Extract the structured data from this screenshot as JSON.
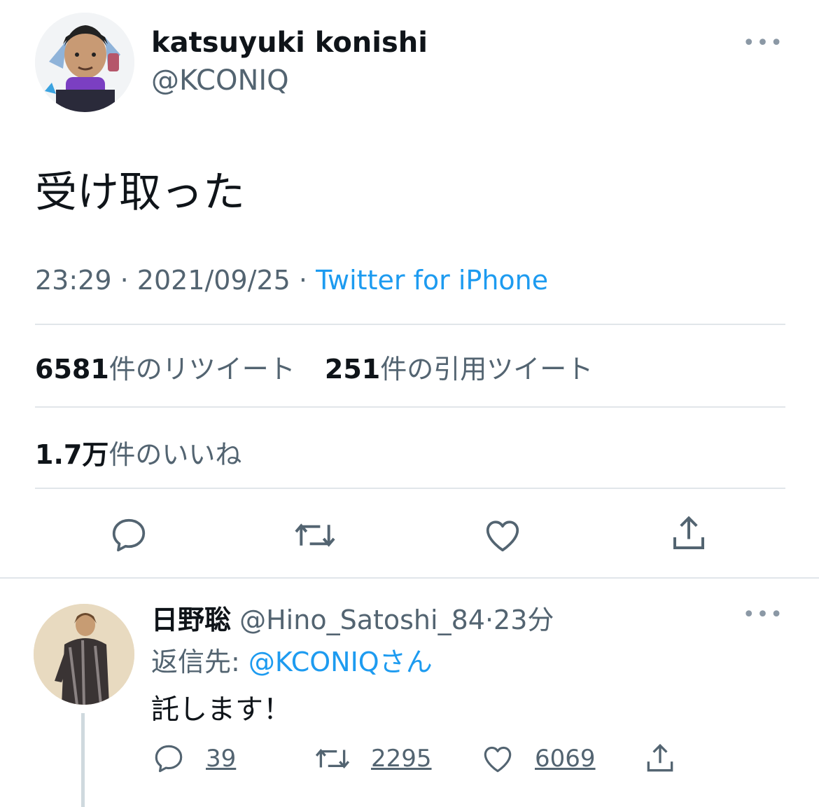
{
  "tweet": {
    "author": {
      "display_name": "katsuyuki konishi",
      "handle": "@KCONIQ"
    },
    "text": "受け取った",
    "time": "23:29",
    "date": "2021/09/25",
    "separator": "·",
    "source": "Twitter for iPhone",
    "stats": {
      "retweets_count": "6581",
      "retweets_label": "件のリツイート",
      "quotes_count": "251",
      "quotes_label": "件の引用ツイート",
      "likes_count": "1.7万",
      "likes_label": "件のいいね"
    },
    "more": "•••"
  },
  "reply": {
    "display_name": "日野聡",
    "handle": "@Hino_Satoshi_84",
    "separator": "·",
    "time_ago": "23分",
    "reply_to_prefix": "返信先: ",
    "reply_to_mention": "@KCONIQ",
    "reply_to_suffix": "さん",
    "text": "託します！",
    "reply_count": "39",
    "retweet_count": "2295",
    "like_count": "6069",
    "more": "•••"
  },
  "colors": {
    "accent": "#1d9bf0",
    "secondary_text": "#536471",
    "primary_text": "#0f1419"
  }
}
